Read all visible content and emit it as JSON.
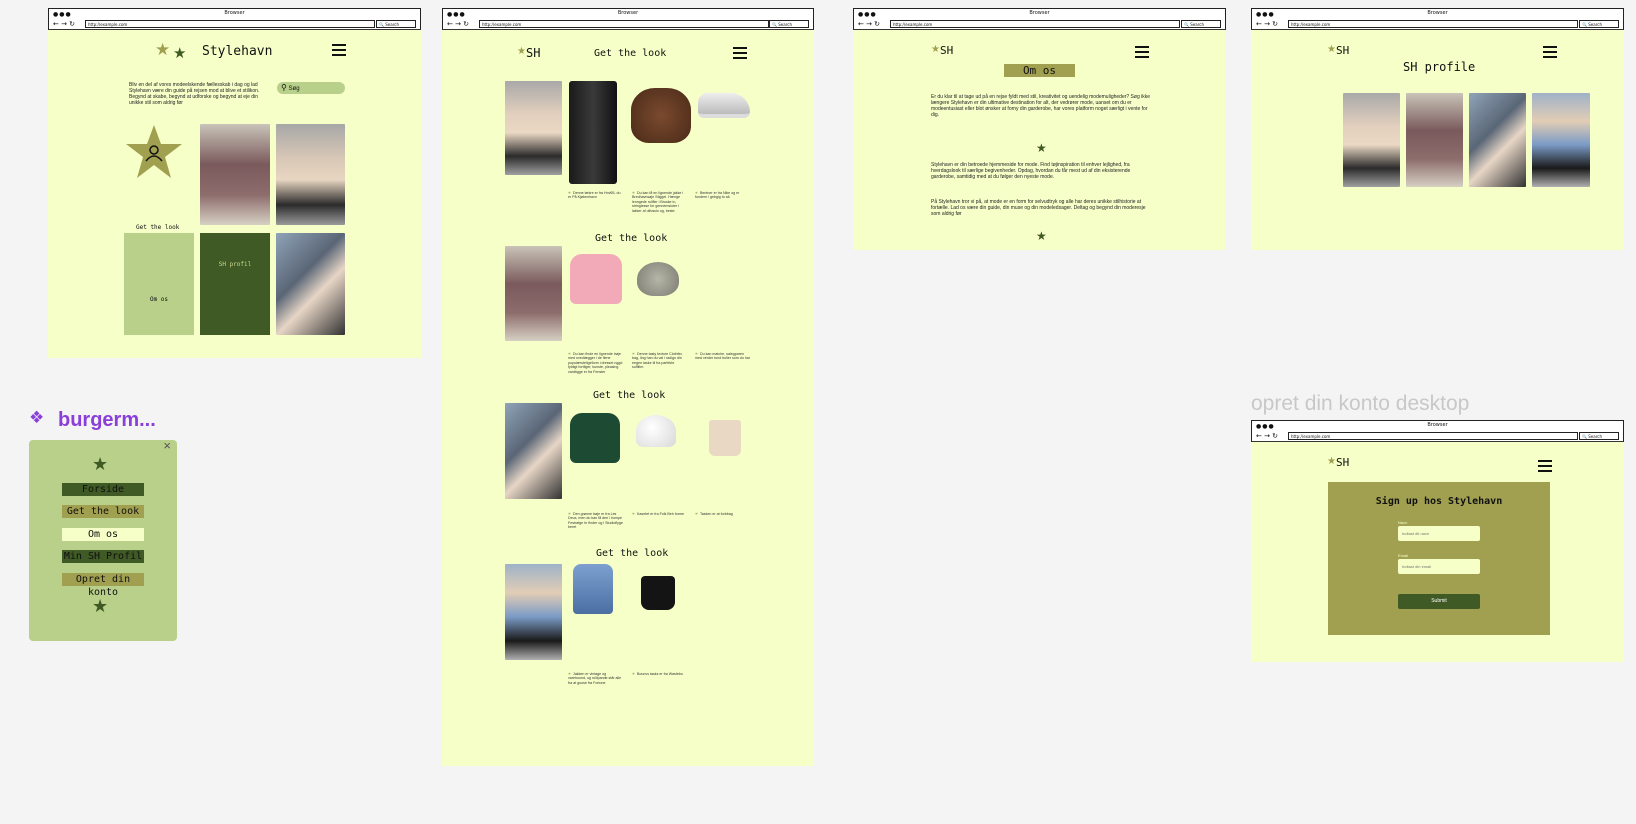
{
  "browser": {
    "title": "Browser",
    "url": "http://example.com",
    "search": "Search",
    "dots": "●●●",
    "nav": "← → ↻"
  },
  "frames": {
    "home": {
      "brand": "Stylehavn",
      "intro": "Bliv en del af vores modeelskende fællesskab i dag og lad Stylehavn være din guide på rejsen mod at blive et stilikon. Begynd at skabe, begynd at udforske og begynd at eje din unikke stil som aldrig før",
      "search_label": "Søg",
      "get_the_look": "Get the look",
      "tile_sh": "SH profil",
      "tile_om": "Om os"
    },
    "getlook": {
      "brand": "SH",
      "sections": [
        {
          "heading": "Get the look",
          "captions": [
            "Denne lækre er fra Hm/65, du er På Kjøbenhavn",
            "Du kan få en lignende jakke i Bredhavnsøje Stiggel. Hænge lenngede rullfler i Bruske in, stringlesse for gennemsluter i lakker af ulfosslo og, beste.",
            "Bentner er fra Nike og er fundern i gebgig to all."
          ]
        },
        {
          "heading": "Get the look",
          "captions": [
            "Du kan finde en lignende trøje med ovedlægger i de flene populærsteilgeform i dresset nggd fyldigt fortfiger, kunste, pleasing vardtigge er fra Fenster",
            "Denne tasty texture Clothfer, bag, ling han du val i radigo din eegen taske til fra parfekte suffiller.",
            "Du kan matche, salegparen med verder tond boller som du har"
          ]
        },
        {
          "heading": "Get the look",
          "captions": [
            "Den grønne trøje er fra Les Deux, men du kan få den i hompe Festrafge hr finder og i Studioflyge beret",
            "Kasetet er fra Folk Beh forme",
            "Tasken er at forbbag"
          ]
        },
        {
          "heading": "Get the look",
          "captions": [
            "Jakken er vintage og varehound, og rullipande står alle fra at goose fra Fortone",
            "Bounvs tasks er fra Wastebu"
          ]
        }
      ]
    },
    "omos": {
      "brand": "SH",
      "title": "Om os",
      "para1": "Er du klar til at tage ud på en rejse fyldt med stil, kreativitet og uendelig modemuligheder? Søg ikke længere Stylehavn er din ultimative destination for alt, der vedrører mode, uanset om du er modeentusiast eller blot ønsker at forny din garderobe, har vores platform noget særligt i vente for dig.",
      "para2": "Stylehavn er din betroede hjemmeside for mode. Find tøjinspiration til enhver lejlighed, fra hverdagslook til særlige begivenheder. Opdag, hvordan du får mest ud af din eksisterende garderobe, samtidig med at du følger den nyeste mode.",
      "para3": "På Stylehavn tror vi på, at mode er en form for selvudtryk og alle har deres unikke stilhistorie at fortælle. Lad os være din guide, din muse og din modeledsager. Deltag og begynd din moderesje som aldrig før"
    },
    "profile": {
      "brand": "SH",
      "title": "SH profile"
    },
    "signup": {
      "label": "opret din konto desktop",
      "brand": "SH",
      "title": "Sign up hos Stylehavn",
      "name_label": "Navn",
      "name_placeholder": "Indtast dit navn",
      "email_label": "Email",
      "email_placeholder": "Indtast din email",
      "submit": "Submit"
    }
  },
  "burger_menu": {
    "component_label": "burgerm...",
    "close": "×",
    "items": [
      "Forside",
      "Get the look",
      "Om os",
      "Min SH Profil",
      "Opret din konto"
    ]
  },
  "colors": {
    "frame_bg": "#f7ffc8",
    "olive": "#a0a050",
    "dark_green": "#3f5a24",
    "pale_green": "#b8d08a",
    "canvas": "#f4f4f4"
  }
}
